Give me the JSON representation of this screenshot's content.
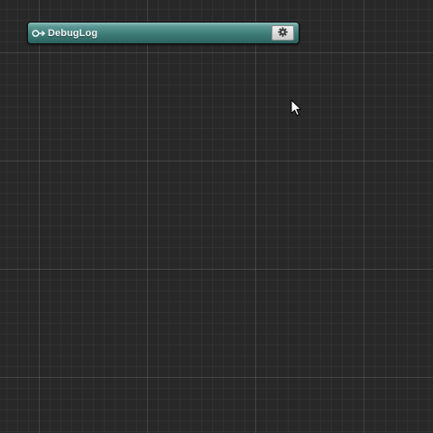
{
  "node": {
    "title": "DebugLog",
    "icon": "key-arrow-icon",
    "settings_icon": "gear-icon",
    "header_color": "#3e7c78"
  },
  "canvas": {
    "background_color": "#282828",
    "grid": true
  },
  "cursor": {
    "icon": "mouse-pointer-icon"
  }
}
